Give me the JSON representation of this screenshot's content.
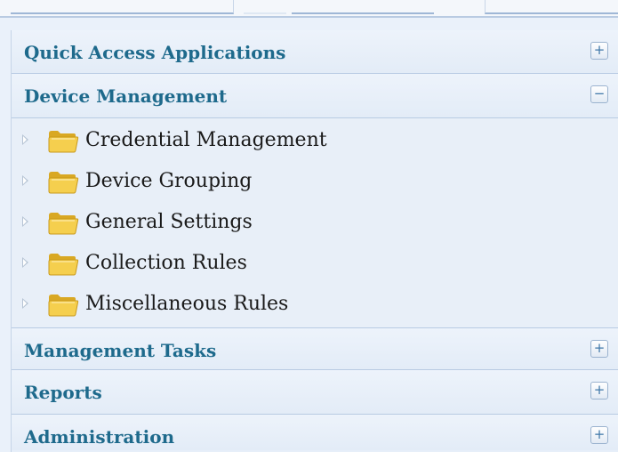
{
  "sections": [
    {
      "title": "Quick Access Applications",
      "toggle": "+",
      "expanded": false
    },
    {
      "title": "Device Management",
      "toggle": "−",
      "expanded": true
    },
    {
      "title": "Management Tasks",
      "toggle": "+",
      "expanded": false
    },
    {
      "title": "Reports",
      "toggle": "+",
      "expanded": false
    },
    {
      "title": "Administration",
      "toggle": "+",
      "expanded": false
    }
  ],
  "device_management_items": [
    {
      "label": "Credential Management",
      "icon": "folder-icon"
    },
    {
      "label": "Device Grouping",
      "icon": "folder-icon"
    },
    {
      "label": "General Settings",
      "icon": "folder-icon"
    },
    {
      "label": "Collection Rules",
      "icon": "folder-icon"
    },
    {
      "label": "Miscellaneous Rules",
      "icon": "folder-icon"
    }
  ],
  "colors": {
    "header_text": "#1e6a8c",
    "panel_background": "#e7eff9",
    "folder": "#f2c744"
  }
}
